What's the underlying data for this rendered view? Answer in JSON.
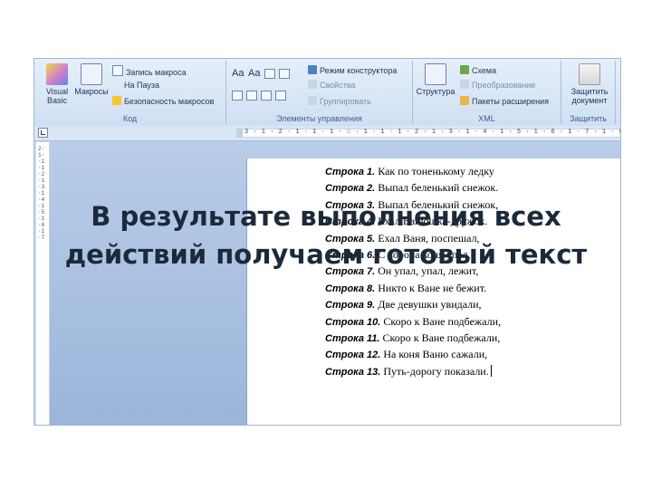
{
  "ribbon": {
    "groups": [
      {
        "title": "Код"
      },
      {
        "title": "Элементы управления"
      },
      {
        "title": "XML"
      },
      {
        "title": "Защитить"
      }
    ],
    "code": {
      "visual_basic": "Visual Basic",
      "macros": "Макросы",
      "record_macro": "Запись макроса",
      "pause": "На Пауза",
      "macro_security": "Безопасность макросов"
    },
    "controls": {
      "aa1": "Aa",
      "aa2": "Aa",
      "design_mode": "Режим конструктора",
      "properties": "Свойства",
      "group": "Группировать"
    },
    "xml": {
      "structure": "Структура",
      "schema": "Схема",
      "transform": "Преобразование",
      "expansion_packs": "Пакеты расширения"
    },
    "protect": {
      "protect_document": "Защитить документ"
    }
  },
  "ruler": {
    "horizontal": "3 · 1 · 2 · 1 · 1 · 1 · ☐ · 1 · 1 · 1 · 2 · 1 · 3 · 1 · 4 · 1 · 5 · 1 · 6 · 1 · 7 · 1 · 8 · 1 · 9 · 1 · 10",
    "vertical": "2·1··1·1·2·1·3·1·4·1·5·1·6·1·7"
  },
  "document": {
    "lines": [
      {
        "label": "Строка 1.",
        "text": " Как по тоненькому ледку"
      },
      {
        "label": "Строка 2.",
        "text": " Выпал беленький снежок."
      },
      {
        "label": "Строка 3.",
        "text": " Выпал беленький снежок,"
      },
      {
        "label": "Строка 4.",
        "text": " Ехал Ванюшка-дружок."
      },
      {
        "label": "Строка 5.",
        "text": " Ехал Ваня, поспешал,"
      },
      {
        "label": "Строка 6.",
        "text": " С ворона коня упал."
      },
      {
        "label": "Строка 7.",
        "text": " Он упал, упал, лежит,"
      },
      {
        "label": "Строка 8.",
        "text": " Никто к Ване не бежит."
      },
      {
        "label": "Строка 9.",
        "text": " Две девушки увидали,"
      },
      {
        "label": "Строка 10.",
        "text": " Скоро к Ване подбежали,"
      },
      {
        "label": "Строка 11.",
        "text": " Скоро к Ване подбежали,"
      },
      {
        "label": "Строка 12.",
        "text": " На коня Ваню сажали,"
      },
      {
        "label": "Строка 13.",
        "text": " Путь-дорогу показали."
      }
    ]
  },
  "slide": {
    "title_line1": "В результате выполнения всех",
    "title_line2": "действий получаем готовый текст"
  },
  "colors": {
    "ribbon": "#dbe6f4",
    "accent": "#3f5f8e",
    "page": "#ffffff"
  }
}
